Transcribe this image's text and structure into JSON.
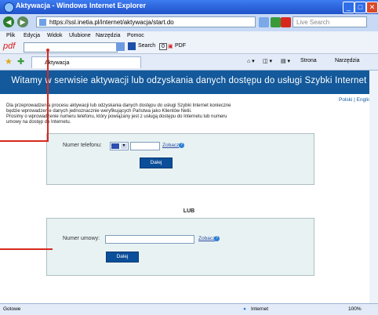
{
  "window": {
    "title": "Aktywacja - Windows Internet Explorer"
  },
  "address": {
    "url": "https://ssl.inetia.pl/internet/aktywacja/start.do",
    "search_placeholder": "Live Search"
  },
  "menu": {
    "items": [
      "Plik",
      "Edycja",
      "Widok",
      "Ulubione",
      "Narzędzia",
      "Pomoc"
    ]
  },
  "pdfbar": {
    "brand": "pdf",
    "search_label": "Search",
    "count": "0",
    "pdf_label": "PDF"
  },
  "favorites": {
    "tab_label": "Aktywacja",
    "strona_label": "Strona",
    "narzedzia_label": "Narzędzia"
  },
  "page": {
    "title": "Witamy w serwisie aktywacji lub odzyskania danych dostępu do usługi Szybki Internet",
    "lang_pl": "Polski",
    "lang_sep": " | ",
    "lang_en": "English",
    "intro_line1": "Dla przeprowadzenia procesu aktywacji lub odzyskania danych dostępu do usługi Szybki Internet konieczne",
    "intro_line2": "będzie wprowadzenie danych jednoznacznie weryfikujących Państwa jako Klientów Netii.",
    "intro_line3": "Prosimy o wprowadzenie numeru telefonu, który powiązany jest z usługą dostępu do Internetu lub numeru",
    "intro_line4": "umowy na dostęp do Internetu.",
    "phone_label": "Numer telefonu:",
    "contract_label": "Numer umowy:",
    "zobacz_label": "Zobacz",
    "dalej_label": "Dalej",
    "or_label": "LUB"
  },
  "status": {
    "left": "Gotowe",
    "zone": "Internet",
    "zoom": "100%"
  }
}
